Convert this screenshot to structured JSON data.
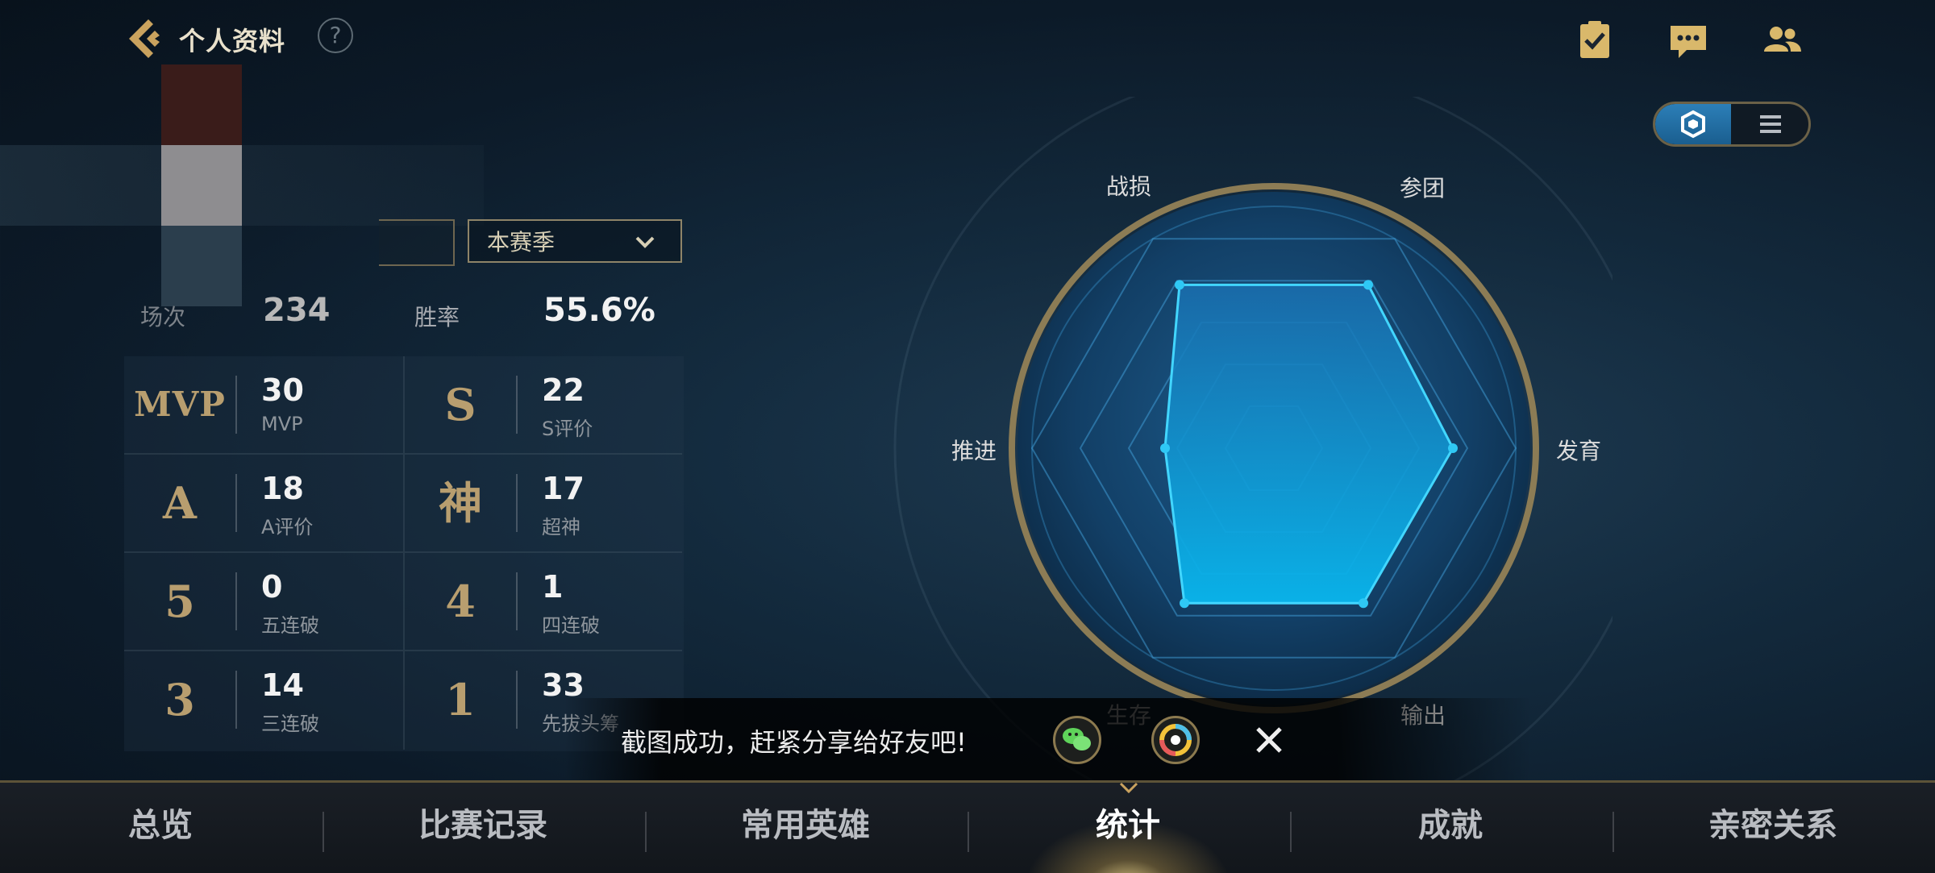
{
  "header": {
    "title": "个人资料",
    "help_label": "?"
  },
  "filters": {
    "season": "本赛季"
  },
  "overview": {
    "games_label": "场次",
    "games_value": "234",
    "winrate_label": "胜率",
    "winrate_value": "55.6%"
  },
  "stats": [
    {
      "icon_text": "MVP",
      "value": "30",
      "label": "MVP"
    },
    {
      "icon_text": "S",
      "value": "22",
      "label": "S评价"
    },
    {
      "icon_text": "A",
      "value": "18",
      "label": "A评价"
    },
    {
      "icon_text": "神",
      "value": "17",
      "label": "超神"
    },
    {
      "icon_text": "5",
      "value": "0",
      "label": "五连破"
    },
    {
      "icon_text": "4",
      "value": "1",
      "label": "四连破"
    },
    {
      "icon_text": "3",
      "value": "14",
      "label": "三连破"
    },
    {
      "icon_text": "1",
      "value": "33",
      "label": "先拔头筹"
    }
  ],
  "radar": {
    "axes": [
      "战损",
      "参团",
      "发育",
      "输出",
      "生存",
      "推进"
    ],
    "values": [
      0.78,
      0.78,
      0.74,
      0.74,
      0.74,
      0.45
    ],
    "color": "#2fc8f5"
  },
  "toast": {
    "message": "截图成功，赶紧分享给好友吧!"
  },
  "tabs": [
    {
      "label": "总览",
      "active": false
    },
    {
      "label": "比赛记录",
      "active": false
    },
    {
      "label": "常用英雄",
      "active": false
    },
    {
      "label": "统计",
      "active": true
    },
    {
      "label": "成就",
      "active": false
    },
    {
      "label": "亲密关系",
      "active": false
    }
  ],
  "icons": {
    "back": "back-arrow-icon",
    "task": "task-clipboard-icon",
    "chat": "chat-bubble-icon",
    "friends": "friends-icon",
    "radar_view": "hexagon-icon",
    "list_view": "list-icon",
    "wechat": "wechat-icon",
    "moments": "moments-icon",
    "close": "close-icon"
  },
  "colors": {
    "gold": "#b89e6f",
    "accent_blue": "#2fc8f5"
  }
}
